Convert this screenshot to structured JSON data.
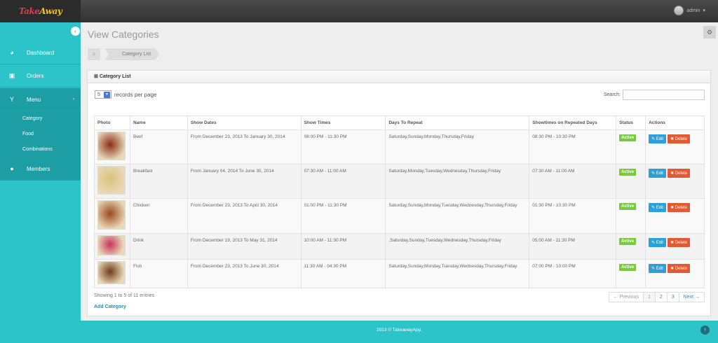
{
  "app": {
    "brand_a": "Take",
    "brand_b": "Away"
  },
  "user": {
    "name": "admin",
    "caret": "▾"
  },
  "sidebar": {
    "collapse_icon": "‹",
    "items": [
      {
        "label": "Dashboard",
        "icon": "◕"
      },
      {
        "label": "Orders",
        "icon": "▣"
      },
      {
        "label": "Menu",
        "icon": "Y"
      },
      {
        "label": "Members",
        "icon": "●"
      }
    ],
    "submenu": [
      "Category",
      "Food",
      "Combinations"
    ],
    "menu_caret": "›"
  },
  "main": {
    "title": "View Categories",
    "settings_icon": "⚙",
    "breadcrumb": {
      "home_icon": "⌂",
      "current": "Category List"
    }
  },
  "panel": {
    "title_icon": "⊞",
    "title": "Category List",
    "records_per_page": "5",
    "records_label": "records per page",
    "search_label": "Search:",
    "search_value": ""
  },
  "table": {
    "headers": [
      "Photo",
      "Name",
      "Show Dates",
      "Show Times",
      "Days To Repeat",
      "Showtimes on Repeated Days",
      "Status",
      "Actions"
    ],
    "rows": [
      {
        "name": "Beef",
        "dates": "From December 23, 2013 To January 30, 2014",
        "times": "08:00 PM - 11:30 PM",
        "days": "Saturday,Sunday,Monday,Thursday,Friday",
        "repeat": "08:30 PM - 10:30 PM",
        "status": "Active",
        "thumb": "#8b2e1a"
      },
      {
        "name": "Breakfast",
        "dates": "From January 04, 2014 To June 30, 2014",
        "times": "07:30 AM - 11:00 AM",
        "days": "Saturday,Monday,Tuesday,Wednesday,Thursday,Friday",
        "repeat": "07:30 AM - 11:00 AM",
        "status": "Active",
        "thumb": "#d9c27a"
      },
      {
        "name": "Chicken",
        "dates": "From December 23, 2013 To April 30, 2014",
        "times": "01:00 PM - 11:30 PM",
        "days": "Saturday,Sunday,Monday,Tuesday,Wednesday,Thursday,Friday",
        "repeat": "01:30 PM - 10:30 PM",
        "status": "Active",
        "thumb": "#9a4a22"
      },
      {
        "name": "Drink",
        "dates": "From December 19, 2013 To May 31, 2014",
        "times": "10:00 AM - 11:30 PM",
        "days": ",Saturday,Sunday,Tuesday,Wednesday,Thursday,Friday",
        "repeat": "05:00 AM - 11:30 PM",
        "status": "Active",
        "thumb": "#c7325a"
      },
      {
        "name": "Fish",
        "dates": "From December 23, 2013 To June 30, 2014",
        "times": "11:30 AM - 04:30 PM",
        "days": "Saturday,Sunday,Monday,Tuesday,Wednesday,Thursday,Friday",
        "repeat": "07:00 PM - 10:00 PM",
        "status": "Active",
        "thumb": "#6e3b1c"
      }
    ],
    "edit_label": "✎ Edit",
    "delete_label": "✖ Delete"
  },
  "footer_info": "Showing 1 to 5 of 11 entries",
  "add_link": "Add Category",
  "pagination": [
    "← Previous",
    "1",
    "2",
    "3",
    "Next →"
  ],
  "footer": {
    "text": "2013 © TakeawayApp.",
    "up_icon": "↑"
  },
  "colors": {
    "accent": "#2cc3c9",
    "active": "#7ac943",
    "edit": "#2ea0d8",
    "delete": "#e05a35"
  }
}
